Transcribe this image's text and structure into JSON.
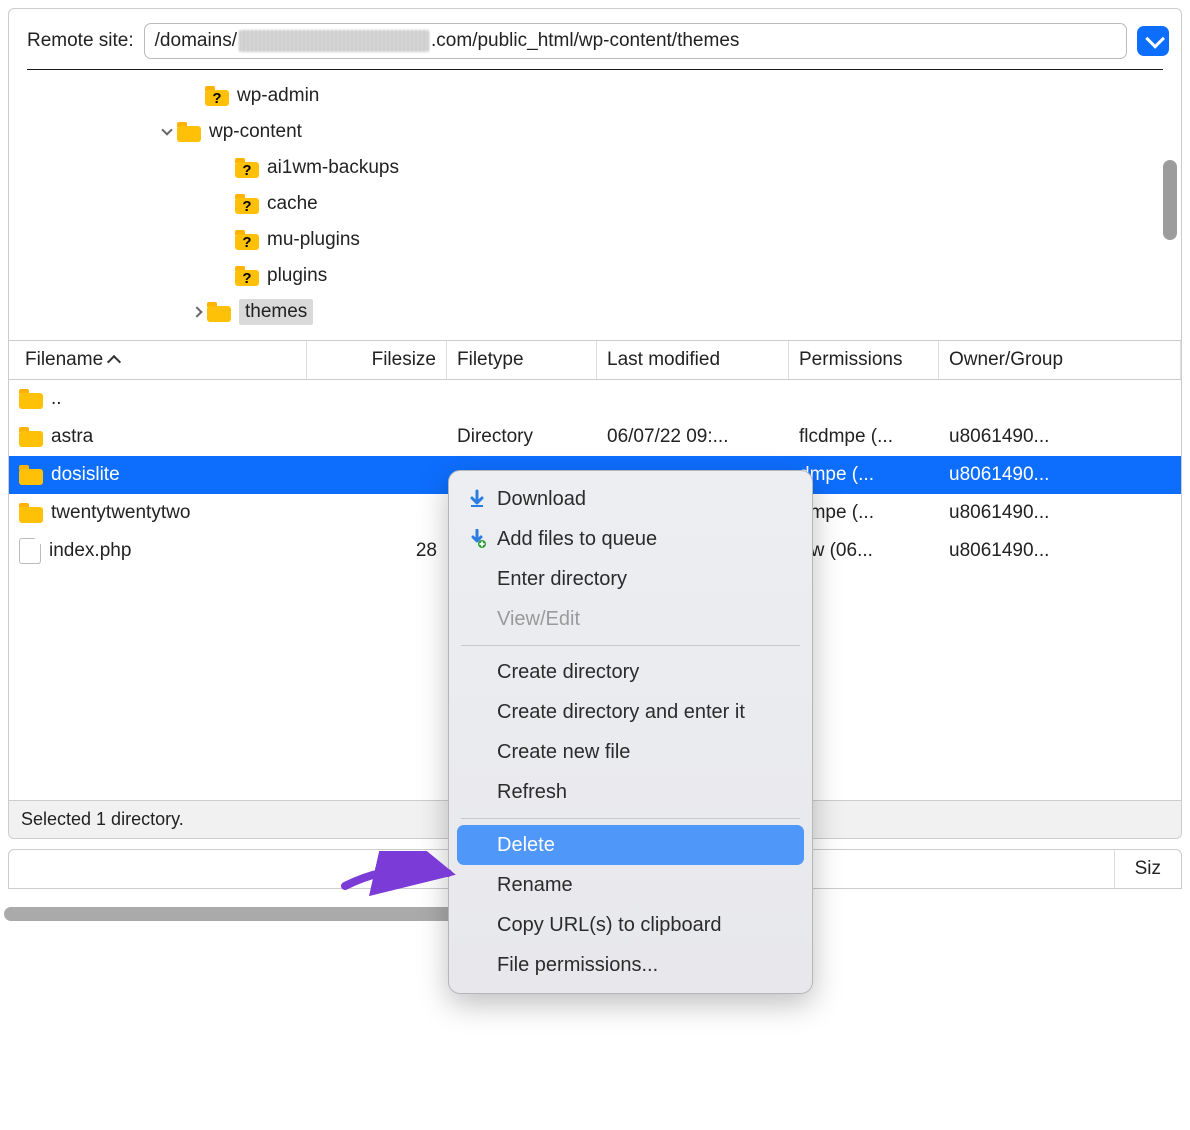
{
  "remote": {
    "label": "Remote site:",
    "path_prefix": "/domains/",
    "path_suffix": ".com/public_html/wp-content/themes"
  },
  "tree": {
    "items": [
      {
        "indent": 176,
        "disclosure": "",
        "iconType": "q",
        "label": "wp-admin",
        "selected": false
      },
      {
        "indent": 148,
        "disclosure": "down",
        "iconType": "plain",
        "label": "wp-content",
        "selected": false
      },
      {
        "indent": 206,
        "disclosure": "",
        "iconType": "q",
        "label": "ai1wm-backups",
        "selected": false
      },
      {
        "indent": 206,
        "disclosure": "",
        "iconType": "q",
        "label": "cache",
        "selected": false
      },
      {
        "indent": 206,
        "disclosure": "",
        "iconType": "q",
        "label": "mu-plugins",
        "selected": false
      },
      {
        "indent": 206,
        "disclosure": "",
        "iconType": "q",
        "label": "plugins",
        "selected": false
      },
      {
        "indent": 178,
        "disclosure": "right",
        "iconType": "plain",
        "label": "themes",
        "selected": true
      }
    ]
  },
  "columns": {
    "filename": "Filename",
    "filesize": "Filesize",
    "filetype": "Filetype",
    "modified": "Last modified",
    "permissions": "Permissions",
    "owner": "Owner/Group"
  },
  "files": [
    {
      "icon": "folder",
      "name": "..",
      "size": "",
      "type": "",
      "modified": "",
      "perm": "",
      "owner": "",
      "selected": false
    },
    {
      "icon": "folder",
      "name": "astra",
      "size": "",
      "type": "Directory",
      "modified": "06/07/22 09:...",
      "perm": "flcdmpe (...",
      "owner": "u8061490...",
      "selected": false
    },
    {
      "icon": "folder",
      "name": "dosislite",
      "size": "",
      "type": "",
      "modified": "",
      "perm": "dmpe (...",
      "owner": "u8061490...",
      "selected": true
    },
    {
      "icon": "folder",
      "name": "twentytwentytwo",
      "size": "",
      "type": "",
      "modified": "",
      "perm": "dmpe (...",
      "owner": "u8061490...",
      "selected": false
    },
    {
      "icon": "file",
      "name": "index.php",
      "size": "28",
      "type": "",
      "modified": "",
      "perm": "frw (06...",
      "owner": "u8061490...",
      "selected": false
    }
  ],
  "status": "Selected 1 directory.",
  "lower": {
    "size_header": "Siz"
  },
  "context_menu": {
    "download": "Download",
    "add_queue": "Add files to queue",
    "enter_dir": "Enter directory",
    "view_edit": "View/Edit",
    "create_dir": "Create directory",
    "create_dir_enter": "Create directory and enter it",
    "create_file": "Create new file",
    "refresh": "Refresh",
    "delete": "Delete",
    "rename": "Rename",
    "copy_url": "Copy URL(s) to clipboard",
    "file_perms": "File permissions..."
  }
}
